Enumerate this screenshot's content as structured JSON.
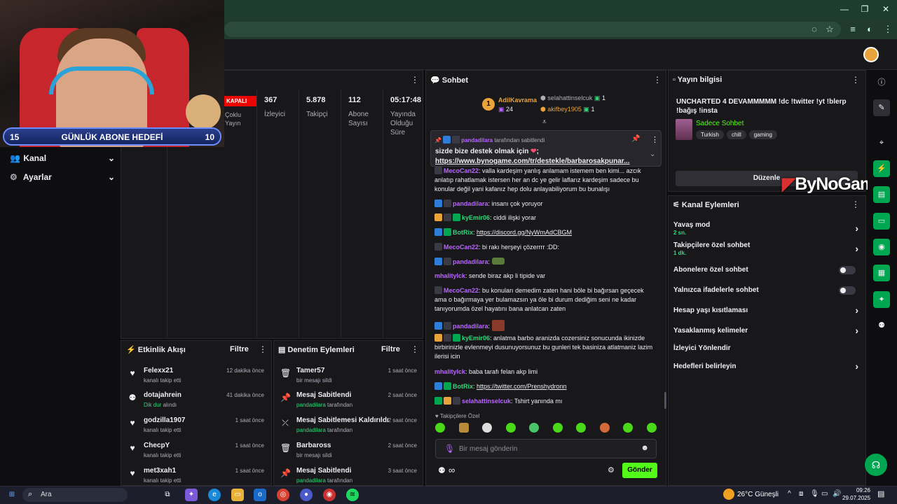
{
  "browser": {
    "window_controls": [
      "—",
      "❐",
      "✕"
    ]
  },
  "webcam": {
    "goal_left": "15",
    "goal_label": "GÜNLÜK ABONE HEDEFİ",
    "goal_right": "10"
  },
  "left_nav": [
    {
      "label": "Kanal",
      "icon": "people-icon"
    },
    {
      "label": "Ayarlar",
      "icon": "gear-icon"
    }
  ],
  "stats": {
    "status": "KAPALI",
    "multi_label": "Çoklu Yayın",
    "items": [
      {
        "value": "367",
        "label": "İzleyici"
      },
      {
        "value": "5.878",
        "label": "Takipçi"
      },
      {
        "value": "112",
        "label": "Abone Sayısı"
      },
      {
        "value": "05:17:48",
        "label": "Yayında Olduğu Süre"
      }
    ]
  },
  "activity": {
    "title": "Etkinlik Akışı",
    "filter": "Filtre",
    "items": [
      {
        "name": "Felexx21",
        "sub": "kanalı takip etti",
        "time": "12 dakika önce",
        "icon": "heart-icon",
        "green": false
      },
      {
        "name": "dotajahrein",
        "sub_green": "Dik dur",
        "sub": " alındı",
        "time": "41 dakika önce",
        "icon": "points-icon",
        "green": true
      },
      {
        "name": "godzilla1907",
        "sub": "kanalı takip etti",
        "time": "1 saat önce",
        "icon": "heart-icon",
        "green": false
      },
      {
        "name": "ChecpY",
        "sub": "kanalı takip etti",
        "time": "1 saat önce",
        "icon": "heart-icon",
        "green": false
      },
      {
        "name": "met3xah1",
        "sub": "kanalı takip etti",
        "time": "1 saat önce",
        "icon": "heart-icon",
        "green": false
      }
    ]
  },
  "moderation": {
    "title": "Denetim Eylemleri",
    "filter": "Filtre",
    "items": [
      {
        "name": "Tamer57",
        "sub": "bir mesajı sildi",
        "time": "1 saat önce",
        "icon": "trash-icon"
      },
      {
        "name": "Mesaj Sabitlendi",
        "sub_green": "pandadilara",
        "sub": " tarafından",
        "time": "2 saat önce",
        "icon": "pin-icon"
      },
      {
        "name": "Mesaj Sabitlemesi Kaldırıldı",
        "sub_green": "pandadilara",
        "sub": " tarafından",
        "time": "2 saat önce",
        "icon": "unpin-icon"
      },
      {
        "name": "Barbaross",
        "sub": "bir mesajı sildi",
        "time": "2 saat önce",
        "icon": "trash-icon"
      },
      {
        "name": "Mesaj Sabitlendi",
        "sub_green": "pandadilara",
        "sub": " tarafından",
        "time": "3 saat önce",
        "icon": "pin-icon"
      }
    ]
  },
  "chat": {
    "title": "Sohbet",
    "leaderboard": {
      "first_name": "AdilKavrama",
      "first_score": "24",
      "second_name": "selahattinselcuk",
      "second_score": "1",
      "third_name": "akifbey1905",
      "third_score": "1"
    },
    "pinned": {
      "by": "pandadilara",
      "by_suffix": " tarafından sabitlendi",
      "text": "sizde bize destek olmak için",
      "link": "https://www.bynogame.com/tr/destekle/barbarosakpunar..."
    },
    "messages": [
      {
        "user": "MecoCan22",
        "color": "#b866ff",
        "text": ": valla kardeşim yanlış anlamam istemem ben kimi... azcık anlatıp rahatlamak istersen her an dc ye gelir laflarız kardeşim sadece bu konular değil yani kafanız hep dolu anlayabiliyorum bu bunalışı"
      },
      {
        "user": "pandadilara",
        "color": "#b866ff",
        "text": ": insanı çok yoruyor"
      },
      {
        "user": "kyEmir06",
        "color": "#31d87b",
        "text": ": ciddi ilişki yorar"
      },
      {
        "user": "BotRix",
        "color": "#31d87b",
        "text": ": ",
        "link": "https://discord.gg/NyWmAdCBGM"
      },
      {
        "user": "MecoCan22",
        "color": "#b866ff",
        "text": ": bi rakı herşeyi çözerrrr :DD:"
      },
      {
        "user": "pandadilara",
        "color": "#b866ff",
        "text": ":"
      },
      {
        "user": "mhalitylck",
        "color": "#b866ff",
        "text": ": sende biraz akp li tipide var"
      },
      {
        "user": "MecoCan22",
        "color": "#b866ff",
        "text": ": bu konuları demedim zaten hani böle bi bağırsan geçecek ama o bağırmaya yer bulamazsın ya öle bi durum dediğim seni ne kadar tanıyorumda özel hayatını bana anlatcan zaten"
      },
      {
        "user": "pandadilara",
        "color": "#b866ff",
        "text": ":"
      },
      {
        "user": "kyEmir06",
        "color": "#31d87b",
        "text": ": anlatma barbo aranizda cozersiniz sonucunda ikinizde birbirinizle evlenmeyi dusunuyorsunuz bu gunleri tek basiniza atlatmaniz lazim ilerisi icin"
      },
      {
        "user": "mhalitylck",
        "color": "#b866ff",
        "text": ": baba tarafı felan akp limi"
      },
      {
        "user": "BotRix",
        "color": "#31d87b",
        "text": ": ",
        "link": "https://twitter.com/Prenshydronn"
      },
      {
        "user": "selahattinselcuk",
        "color": "#b866ff",
        "text": ": Tshirt yanında mı"
      }
    ],
    "followers_only": "Takipçilere Özel",
    "input_placeholder": "Bir mesaj gönderin",
    "send_label": "Gönder"
  },
  "stream_info": {
    "title": "Yayın bilgisi",
    "stream_title": "UNCHARTED 4 DEVAMMMMM !dc !twitter !yt !blerp !bağış !insta",
    "category": "Sadece Sohbet",
    "tags": [
      "Turkish",
      "chill",
      "gaming"
    ],
    "edit_label": "Düzenle",
    "watermark": "ByNoGame"
  },
  "channel_actions": {
    "title": "Kanal Eylemleri",
    "items": [
      {
        "label": "Yavaş mod",
        "sub": "2 sn.",
        "type": "chevron"
      },
      {
        "label": "Takipçilere özel sohbet",
        "sub": "1 dk.",
        "type": "chevron"
      },
      {
        "label": "Abonelere özel sohbet",
        "sub": "",
        "type": "toggle"
      },
      {
        "label": "Yalnızca ifadelerle sohbet",
        "sub": "",
        "type": "toggle"
      },
      {
        "label": "Hesap yaşı kısıtlaması",
        "sub": "",
        "type": "chevron"
      },
      {
        "label": "Yasaklanmış kelimeler",
        "sub": "",
        "type": "chevron"
      },
      {
        "label": "İzleyici Yönlendir",
        "sub": "",
        "type": "none"
      },
      {
        "label": "Hedefleri belirleyin",
        "sub": "",
        "type": "chevron"
      }
    ]
  },
  "taskbar": {
    "search": "Ara",
    "weather": "26°C  Güneşli",
    "time": "09:26",
    "date": "29.07.2025"
  },
  "colors": {
    "accent": "#53fc18",
    "bg": "#0e0e10",
    "panel": "#18181b",
    "green_text": "#31d87b",
    "purple_text": "#b866ff"
  }
}
